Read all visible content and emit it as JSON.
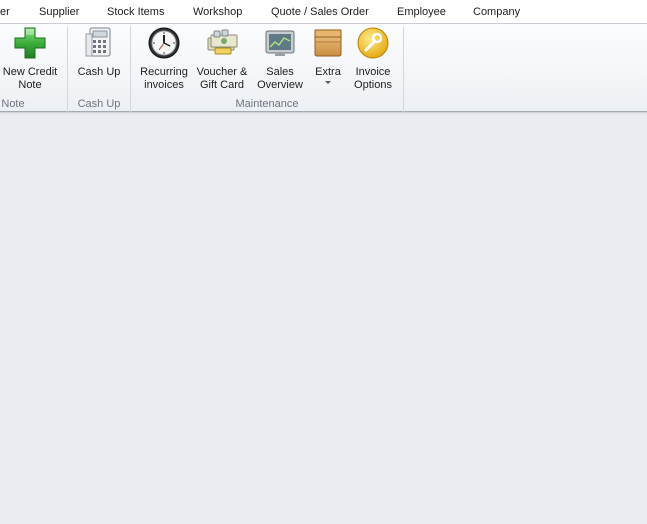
{
  "menu": {
    "tabs": [
      {
        "label": "er"
      },
      {
        "label": "Supplier"
      },
      {
        "label": "Stock Items"
      },
      {
        "label": "Workshop"
      },
      {
        "label": "Quote / Sales Order"
      },
      {
        "label": "Employee"
      },
      {
        "label": "Company"
      }
    ]
  },
  "ribbon": {
    "groups": [
      {
        "label": "Note",
        "buttons": [
          {
            "label": "New Credit\nNote",
            "icon": "green-plus-icon"
          }
        ]
      },
      {
        "label": "Cash Up",
        "buttons": [
          {
            "label": "Cash Up",
            "icon": "calculator-icon"
          }
        ]
      },
      {
        "label": "Maintenance",
        "buttons": [
          {
            "label": "Recurring\ninvoices",
            "icon": "clock-icon"
          },
          {
            "label": "Voucher &\nGift Card",
            "icon": "voucher-icon"
          },
          {
            "label": "Sales\nOverview",
            "icon": "monitor-chart-icon"
          },
          {
            "label": "Extra",
            "icon": "box-icon"
          },
          {
            "label": "Invoice\nOptions",
            "icon": "wrench-icon"
          }
        ]
      }
    ]
  }
}
